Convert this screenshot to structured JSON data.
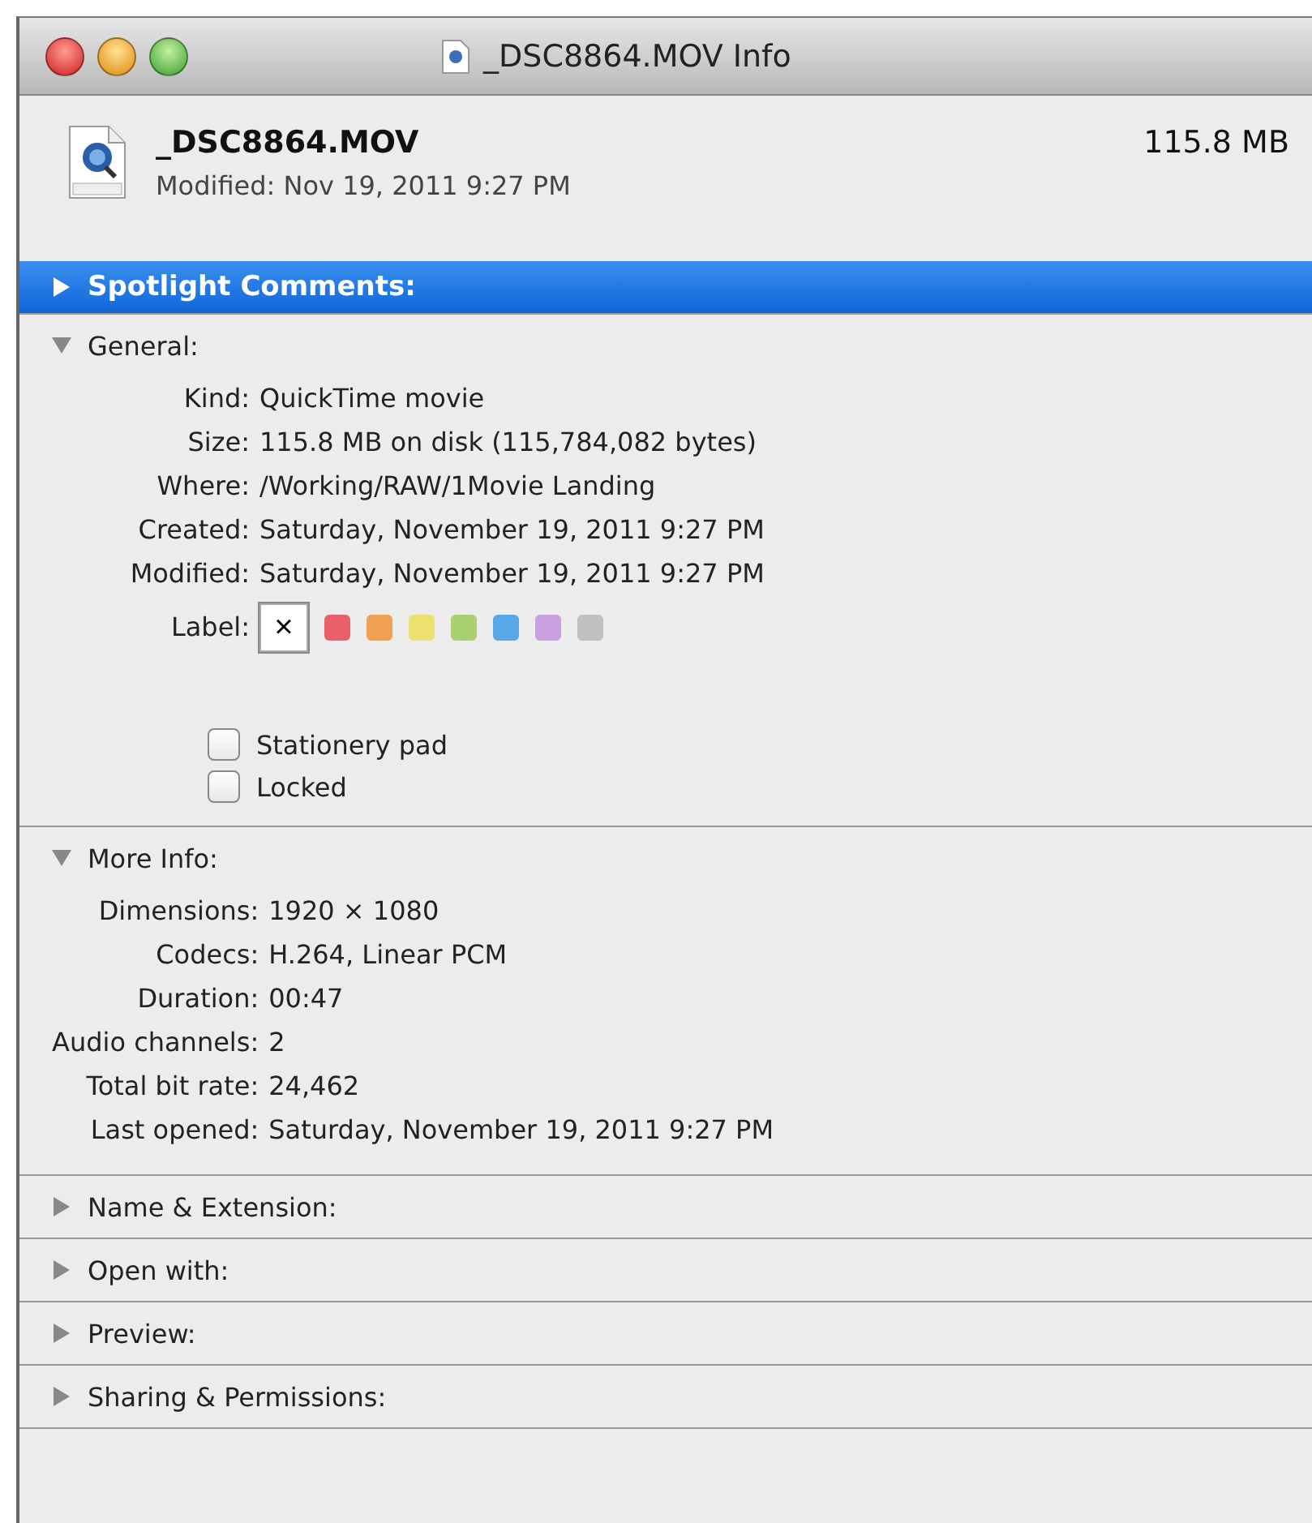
{
  "window": {
    "title": "_DSC8864.MOV Info"
  },
  "header": {
    "name": "_DSC8864.MOV",
    "size": "115.8 MB",
    "modified": "Modified: Nov 19, 2011 9:27 PM"
  },
  "sections": [
    {
      "title": "Spotlight Comments:",
      "expanded": false,
      "selected": true
    },
    {
      "title": "General:",
      "expanded": true,
      "selected": false,
      "kind": "general",
      "rows": [
        {
          "label": "Kind:",
          "value": "QuickTime movie"
        },
        {
          "label": "Size:",
          "value": "115.8 MB on disk (115,784,082 bytes)"
        },
        {
          "label": "Where:",
          "value": "/Working/RAW/1Movie Landing"
        },
        {
          "label": "Created:",
          "value": "Saturday, November 19, 2011 9:27 PM"
        },
        {
          "label": "Modified:",
          "value": "Saturday, November 19, 2011 9:27 PM"
        }
      ],
      "label_title": "Label:",
      "label_options": [
        {
          "kind": "none",
          "text": "×",
          "selected": true
        },
        {
          "kind": "color",
          "color": "#e8606a",
          "selected": false
        },
        {
          "kind": "color",
          "color": "#f0a050",
          "selected": false
        },
        {
          "kind": "color",
          "color": "#ece070",
          "selected": false
        },
        {
          "kind": "color",
          "color": "#a8d070",
          "selected": false
        },
        {
          "kind": "color",
          "color": "#58a8e8",
          "selected": false
        },
        {
          "kind": "color",
          "color": "#c8a0e0",
          "selected": false
        },
        {
          "kind": "color",
          "color": "#c0c0c0",
          "selected": false
        }
      ],
      "checkboxes": [
        {
          "label": "Stationery pad",
          "checked": false
        },
        {
          "label": "Locked",
          "checked": false
        }
      ]
    },
    {
      "title": "More Info:",
      "expanded": true,
      "selected": false,
      "kind": "info",
      "rows": [
        {
          "label": "Dimensions:",
          "value": "1920 × 1080"
        },
        {
          "label": "Codecs:",
          "value": "H.264, Linear PCM"
        },
        {
          "label": "Duration:",
          "value": "00:47"
        },
        {
          "label": "Audio channels:",
          "value": "2"
        },
        {
          "label": "Total bit rate:",
          "value": "24,462"
        },
        {
          "label": "Last opened:",
          "value": "Saturday, November 19, 2011 9:27 PM"
        }
      ]
    },
    {
      "title": "Name & Extension:",
      "expanded": false,
      "selected": false
    },
    {
      "title": "Open with:",
      "expanded": false,
      "selected": false
    },
    {
      "title": "Preview:",
      "expanded": false,
      "selected": false
    },
    {
      "title": "Sharing & Permissions:",
      "expanded": false,
      "selected": false
    }
  ]
}
